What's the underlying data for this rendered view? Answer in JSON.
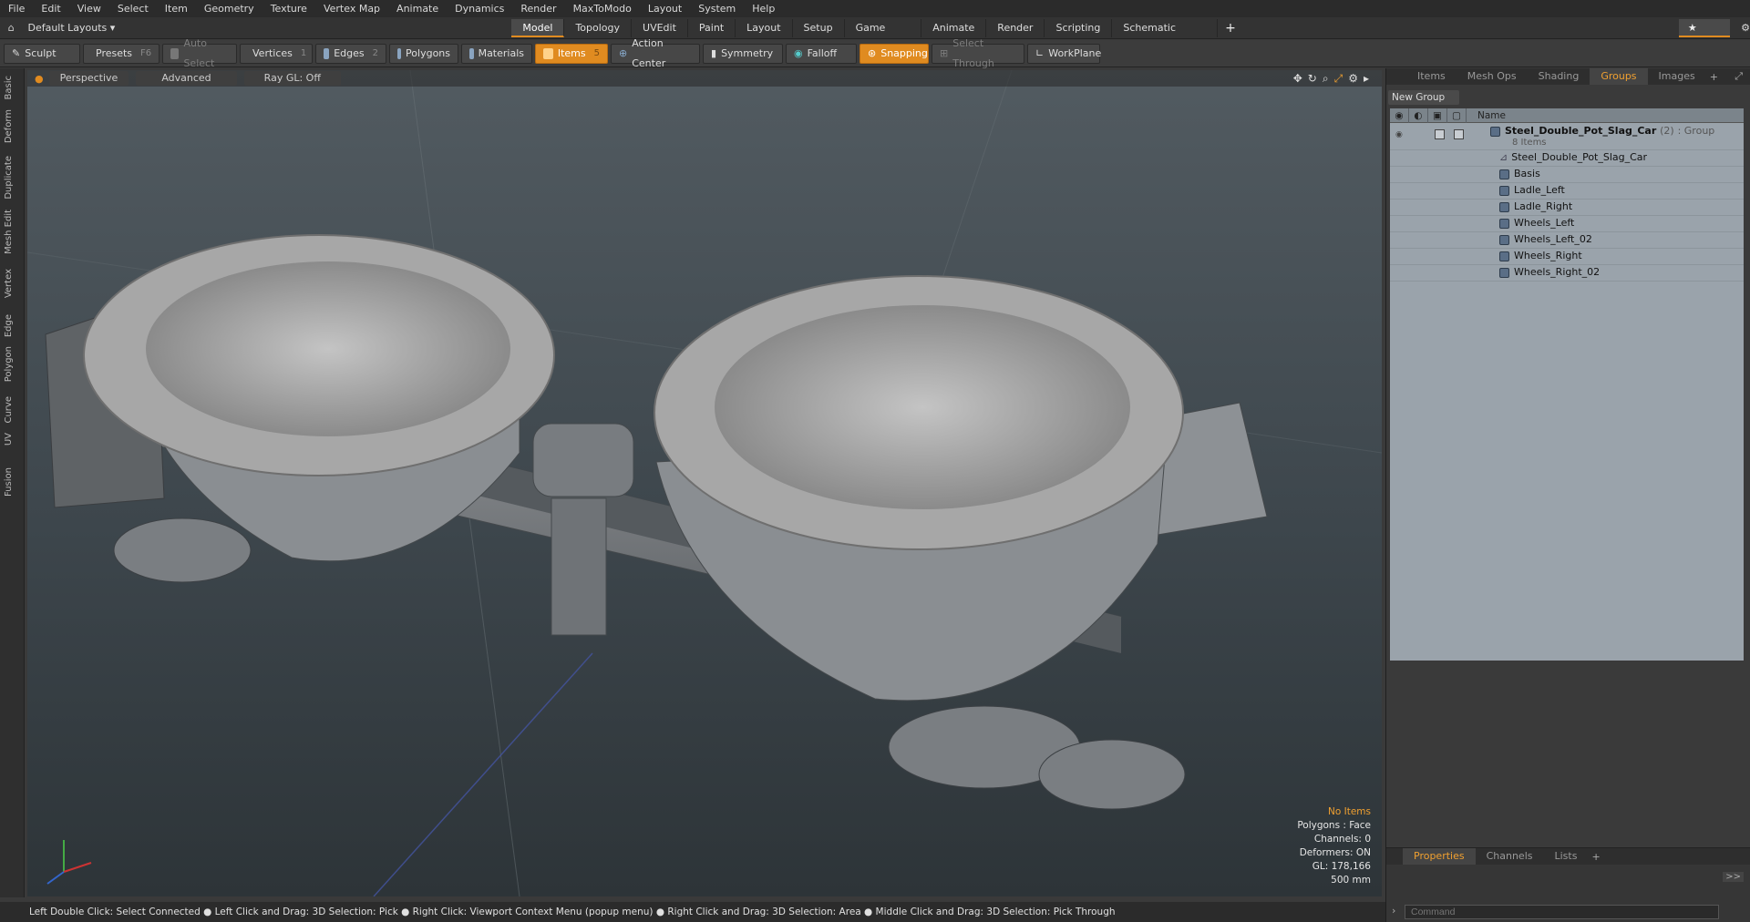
{
  "menu": [
    "File",
    "Edit",
    "View",
    "Select",
    "Item",
    "Geometry",
    "Texture",
    "Vertex Map",
    "Animate",
    "Dynamics",
    "Render",
    "MaxToModo",
    "Layout",
    "System",
    "Help"
  ],
  "layout_dropdown": "Default Layouts ▾",
  "layout_tabs": [
    "Model",
    "Topology",
    "UVEdit",
    "Paint",
    "Layout",
    "Setup",
    "Game Tools",
    "Animate",
    "Render",
    "Scripting",
    "Schematic Fusion"
  ],
  "layout_only": "★ Only",
  "toolbar": {
    "sculpt": "Sculpt",
    "presets": "Presets",
    "presets_key": "F6",
    "auto_select": "Auto Select",
    "vertices": "Vertices",
    "vertices_key": "1",
    "edges": "Edges",
    "edges_key": "2",
    "polygons": "Polygons",
    "materials": "Materials",
    "items": "Items",
    "items_key": "5",
    "action_center": "Action Center",
    "symmetry": "Symmetry",
    "falloff": "Falloff",
    "snapping": "Snapping",
    "select_through": "Select Through",
    "workplane": "WorkPlane"
  },
  "left_tabs": [
    "Basic",
    "Deform",
    "Duplicate",
    "Mesh Edit",
    "Vertex",
    "Edge",
    "Polygon",
    "Curve",
    "UV",
    "Fusion"
  ],
  "viewport": {
    "perspective": "Perspective",
    "advanced": "Advanced",
    "raygl": "Ray GL: Off",
    "info": {
      "no_items": "No Items",
      "polygons": "Polygons : Face",
      "channels": "Channels: 0",
      "deformers": "Deformers: ON",
      "gl": "GL: 178,166",
      "unit": "500 mm"
    }
  },
  "status": "Left Double Click: Select Connected ● Left Click and Drag: 3D Selection: Pick ● Right Click: Viewport Context Menu (popup menu) ● Right Click and Drag: 3D Selection: Area ● Middle Click and Drag: 3D Selection: Pick Through",
  "right_panel": {
    "tabs": [
      "Items",
      "Mesh Ops",
      "Shading",
      "Groups",
      "Images"
    ],
    "new_group": "New Group",
    "name_col": "Name",
    "group": {
      "name": "Steel_Double_Pot_Slag_Car",
      "count": "(2)",
      "type": ": Group",
      "sub": "8 Items"
    },
    "items": [
      "Steel_Double_Pot_Slag_Car",
      "Basis",
      "Ladle_Left",
      "Ladle_Right",
      "Wheels_Left",
      "Wheels_Left_02",
      "Wheels_Right",
      "Wheels_Right_02"
    ]
  },
  "props_tabs": [
    "Properties",
    "Channels",
    "Lists"
  ],
  "command_placeholder": "Command"
}
